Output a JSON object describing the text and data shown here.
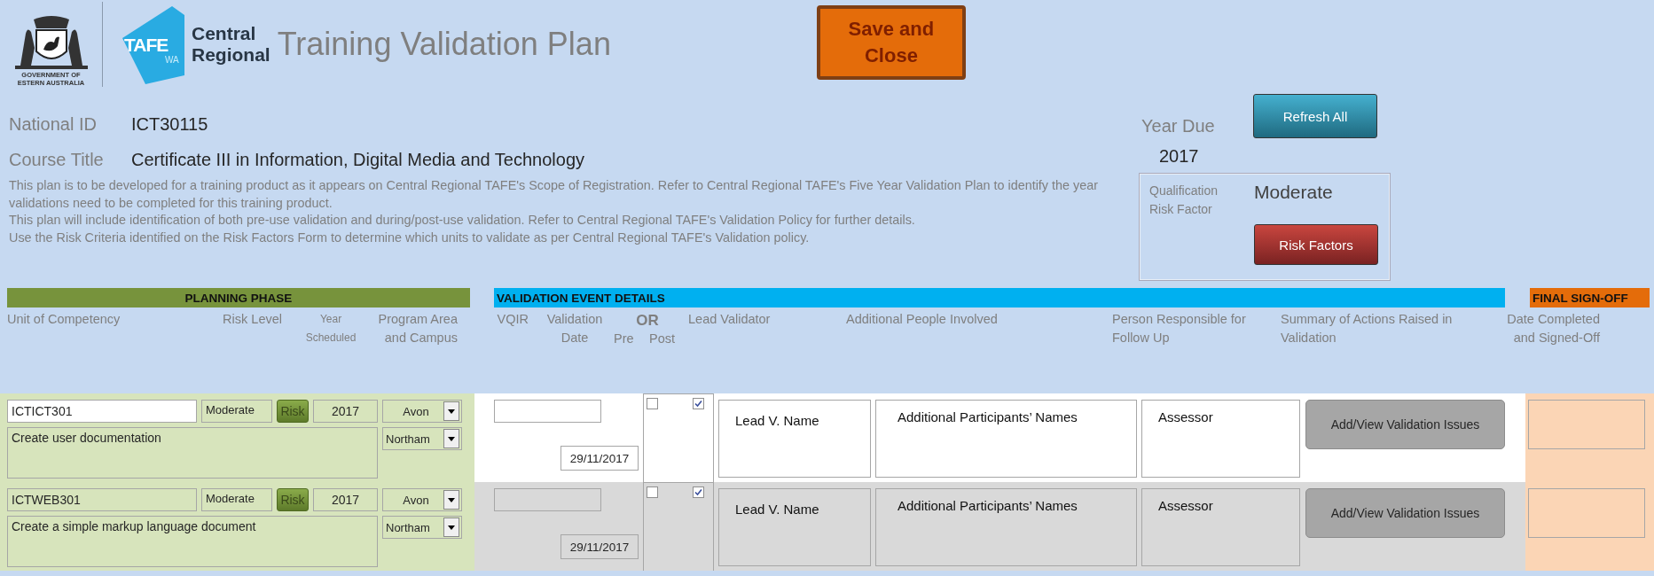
{
  "header": {
    "crest_caption": [
      "GOVERNMENT OF",
      "ESTERN AUSTRALIA"
    ],
    "badge": "TAFE",
    "badge_sub": "WA",
    "brand": [
      "Central",
      "Regional"
    ],
    "title": "Training Validation Plan",
    "save_button": "Save and Close"
  },
  "national_id": {
    "label": "National ID",
    "value": "ICT30115"
  },
  "course_title": {
    "label": "Course Title",
    "value": "Certificate III in Information, Digital Media and Technology"
  },
  "year_due": {
    "label": "Year Due",
    "value": "2017"
  },
  "refresh_button": "Refresh All",
  "description": [
    "This plan is to be developed for a training product as it appears on Central Regional TAFE's Scope of Registration. Refer to Central Regional TAFE's Five Year Validation Plan to identify the year validations need to be completed for this training product.",
    "This plan will include identification of both pre-use validation and during/post-use validation. Refer to Central Regional TAFE's Validation Policy for further details.",
    "Use the Risk Criteria identified on the Risk Factors Form to determine which units to validate as per Central Regional TAFE's Validation policy."
  ],
  "risk_panel": {
    "label": "Qualification Risk Factor",
    "value": "Moderate",
    "button": "Risk Factors"
  },
  "sections": [
    {
      "kind": "planning",
      "title": "PLANNING PHASE",
      "color": "#77933c"
    },
    {
      "kind": "validation",
      "title": "VALIDATION EVENT DETAILS",
      "color": "#00b0f0"
    },
    {
      "kind": "final",
      "title": "FINAL SIGN-OFF",
      "color": "#e46c0a"
    }
  ],
  "columns": {
    "unit": "Unit of Competency",
    "risk_level": "Risk Level",
    "year": "Year Scheduled",
    "campus": "Program Area and Campus",
    "vqir": "VQIR",
    "date": "Validation Date",
    "or": "OR",
    "pre": "Pre",
    "post": "Post",
    "lead": "Lead Validator",
    "additional": "Additional People Involved",
    "responsible": "Person Responsible for Follow Up",
    "summary": "Summary of Actions Raised in Validation",
    "signoff": "Date Completed and Signed-Off"
  },
  "rows": [
    {
      "shaded": false,
      "unit_code": "ICTICT301",
      "unit_title": "Create user documentation",
      "risk_level": "Moderate",
      "risk_button": "Risk",
      "year": "2017",
      "campus": "Avon",
      "campus_2": "Northam",
      "validation_date": "29/11/2017",
      "pre": false,
      "post": true,
      "lead_validator": "Lead V. Name",
      "additional_people": "Additional Participants’ Names",
      "person_responsible": "Assessor",
      "actions_button": "Add/View Validation Issues"
    },
    {
      "shaded": true,
      "unit_code": "ICTWEB301",
      "unit_title": "Create a simple markup language document",
      "risk_level": "Moderate",
      "risk_button": "Risk",
      "year": "2017",
      "campus": "Avon",
      "campus_2": "Northam",
      "validation_date": "29/11/2017",
      "pre": false,
      "post": true,
      "lead_validator": "Lead V. Name",
      "additional_people": "Additional Participants’ Names",
      "person_responsible": "Assessor",
      "actions_button": "Add/View Validation Issues"
    }
  ]
}
